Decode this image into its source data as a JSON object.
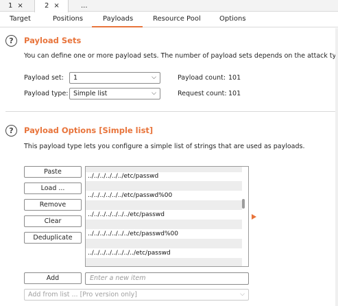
{
  "instance_tabs": [
    {
      "label": "1",
      "close": "×"
    },
    {
      "label": "2",
      "close": "×"
    },
    {
      "label": "..."
    }
  ],
  "sub_tabs": [
    "Target",
    "Positions",
    "Payloads",
    "Resource Pool",
    "Options"
  ],
  "active_sub_tab": "Payloads",
  "payload_sets": {
    "help_glyph": "?",
    "title": "Payload Sets",
    "description": "You can define one or more payload sets. The number of payload sets depends on the attack type d",
    "payload_set_label": "Payload set:",
    "payload_set_value": "1",
    "payload_count_label": "Payload count:",
    "payload_count_value": "101",
    "payload_type_label": "Payload type:",
    "payload_type_value": "Simple list",
    "request_count_label": "Request count:",
    "request_count_value": "101"
  },
  "payload_options": {
    "help_glyph": "?",
    "title": "Payload Options [Simple list]",
    "description": "This payload type lets you configure a simple list of strings that are used as payloads.",
    "buttons": [
      "Paste",
      "Load ...",
      "Remove",
      "Clear",
      "Deduplicate"
    ],
    "list_items": [
      "",
      "../../../../../../etc/passwd",
      "",
      "../../../../../../etc/passwd%00",
      "",
      "../../../../../../../etc/passwd",
      "",
      "../../../../../../../etc/passwd%00",
      "",
      "../../../../../../../../etc/passwd",
      ""
    ],
    "add_button": "Add",
    "add_placeholder": "Enter a new item",
    "add_from_list": "Add from list ... [Pro version only]"
  },
  "colors": {
    "accent": "#e8743b"
  }
}
